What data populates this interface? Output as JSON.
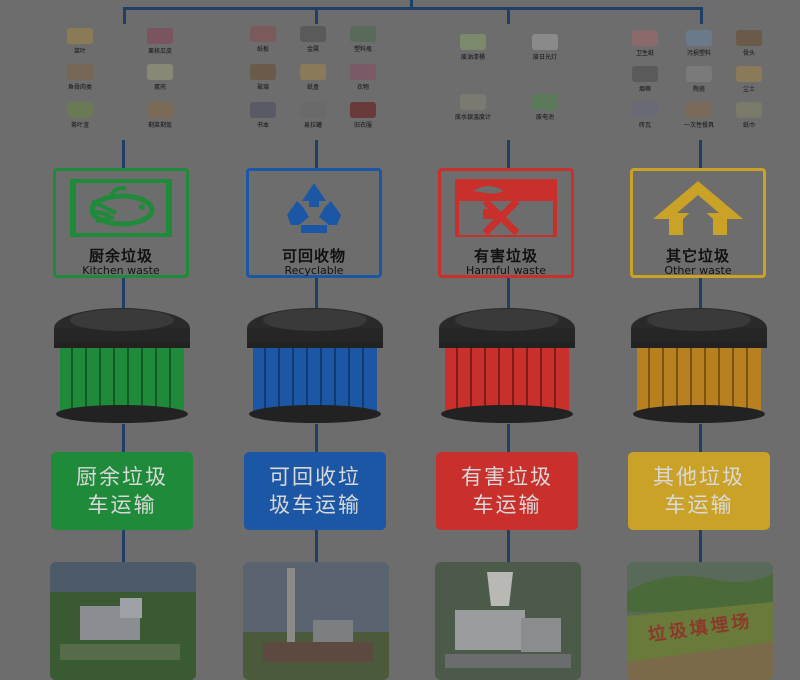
{
  "colors": {
    "kitchen": "#1f8a3a",
    "recyclable": "#1c57a6",
    "harmful": "#c9302c",
    "other": "#c9a227",
    "background": "#6d6d6d",
    "connector": "#1f3f66"
  },
  "columns": [
    {
      "key": "kitchen",
      "items": [
        "菜叶",
        "果核瓜皮",
        "鱼骨肉类",
        "蛋壳",
        "茶叶渣",
        "剩菜剩饭"
      ],
      "sign_icon": "kitchen-waste-icon",
      "sign_cn": "厨余垃圾",
      "sign_en": "Kitchen waste",
      "truck_lines": [
        "厨余垃圾",
        "车运输"
      ]
    },
    {
      "key": "recyclable",
      "items": [
        "纸板",
        "金属",
        "塑料瓶",
        "玻璃",
        "纸盒",
        "衣物",
        "书本",
        "易拉罐",
        "旧衣服"
      ],
      "sign_icon": "recycle-icon",
      "sign_cn": "可回收物",
      "sign_en": "Recyclable",
      "truck_lines": [
        "可回收垃",
        "圾车运输"
      ]
    },
    {
      "key": "harmful",
      "items": [
        "废油漆桶",
        "废日光灯",
        "废水银温度计",
        "废电池"
      ],
      "sign_icon": "harmful-waste-icon",
      "sign_cn": "有害垃圾",
      "sign_en": "Harmful waste",
      "truck_lines": [
        "有害垃圾",
        "车运输"
      ]
    },
    {
      "key": "other",
      "items": [
        "卫生纸",
        "污损塑料",
        "骨头",
        "烟蒂",
        "陶瓷",
        "尘土",
        "砖瓦",
        "一次性餐具",
        "纸巾"
      ],
      "sign_icon": "other-waste-icon",
      "sign_cn": "其它垃圾",
      "sign_en": "Other waste",
      "truck_lines": [
        "其他垃圾",
        "车运输"
      ]
    }
  ],
  "landfill_sign": "垃圾填埋场"
}
